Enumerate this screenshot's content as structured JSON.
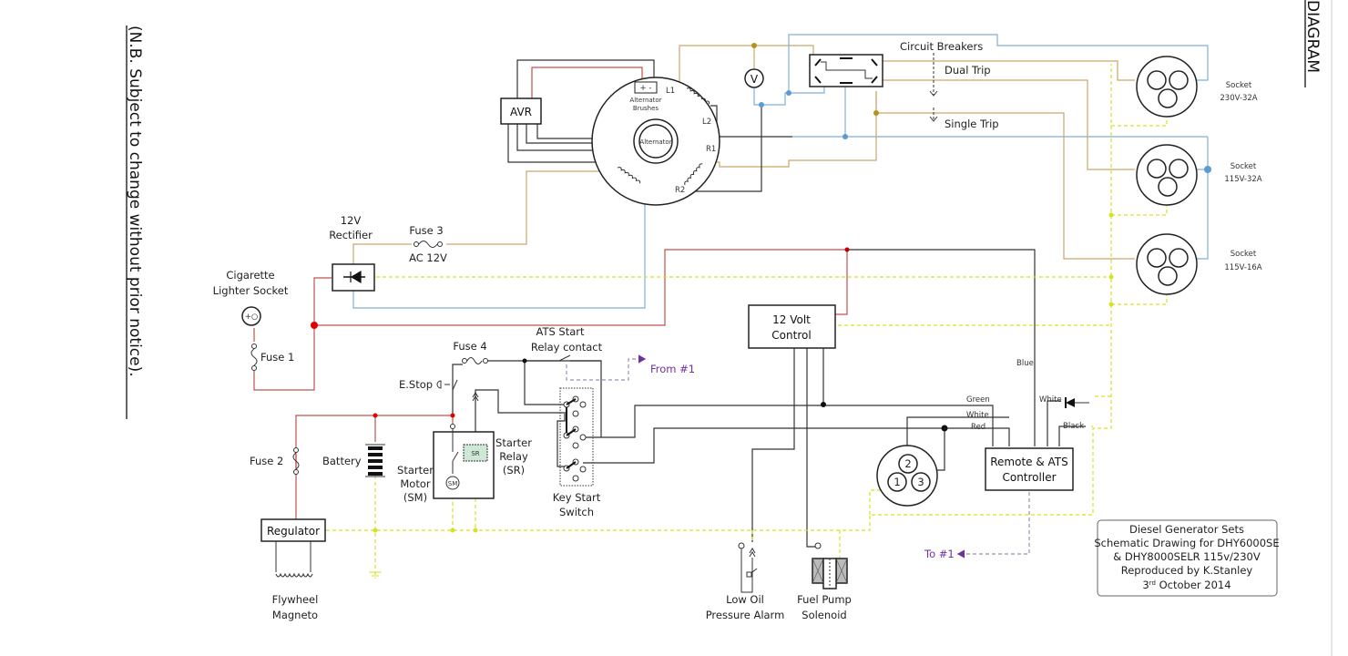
{
  "title": "DIAGRAM",
  "notice": "(N.B. Subject to change without prior notice).",
  "colors": {
    "wire_black": "#333333",
    "wire_red": "#c0504d",
    "wire_blue": "#7fb1d8",
    "wire_brown": "#c9a86a",
    "wire_yellow_earth": "#d9e021",
    "signal_purple": "#7030a0",
    "junction_red": "#e00000",
    "junction_blue": "#5b9bd5",
    "junction_brown": "#b8901f"
  },
  "components": {
    "avr": "AVR",
    "alternator": "Alternator",
    "brushes": {
      "polarity": "+ -",
      "line1": "Alternator",
      "line2": "Brushes"
    },
    "windings": {
      "l1": "L1",
      "l2": "L2",
      "r1": "R1",
      "r2": "R2"
    },
    "voltmeter": "V",
    "circuit_breakers": "Circuit Breakers",
    "dual_trip": "Dual Trip",
    "single_trip": "Single Trip",
    "sockets": [
      {
        "name": "Socket",
        "rating": "230V-32A"
      },
      {
        "name": "Socket",
        "rating": "115V-32A"
      },
      {
        "name": "Socket",
        "rating": "115V-16A"
      }
    ],
    "rectifier": {
      "line1": "12V",
      "line2": "Rectifier"
    },
    "fuse3": {
      "name": "Fuse 3",
      "rating": "AC 12V"
    },
    "cigarette": {
      "line1": "Cigarette",
      "line2": "Lighter Socket",
      "symbol": "+○"
    },
    "fuse1": "Fuse 1",
    "fuse2": "Fuse 2",
    "fuse4": "Fuse 4",
    "estop": "E.Stop",
    "battery": "Battery",
    "regulator": "Regulator",
    "magneto": {
      "line1": "Flywheel",
      "line2": "Magneto"
    },
    "starter_motor": {
      "line1": "Starter",
      "line2": "Motor",
      "line3": "(SM)",
      "symbol": "SM"
    },
    "starter_relay": {
      "line1": "Starter",
      "line2": "Relay",
      "line3": "(SR)",
      "symbol": "SR"
    },
    "ats_relay": {
      "line1": "ATS Start",
      "line2": "Relay contact"
    },
    "from_ref": "From #1",
    "to_ref": "To #1",
    "key_switch": {
      "line1": "Key Start",
      "line2": "Switch"
    },
    "control12v": {
      "line1": "12 Volt",
      "line2": "Control"
    },
    "remote_ats": {
      "line1": "Remote & ATS",
      "line2": "Controller"
    },
    "remote_plug_pins": [
      "2",
      "1",
      "3"
    ],
    "wire_labels": {
      "blue": "Blue",
      "green": "Green",
      "white1": "White",
      "red": "Red",
      "white2": "White",
      "black": "Black"
    },
    "low_oil": {
      "line1": "Low Oil",
      "line2": "Pressure Alarm"
    },
    "fuel_pump": {
      "line1": "Fuel Pump",
      "line2": "Solenoid"
    }
  },
  "title_block": {
    "line1": "Diesel Generator Sets",
    "line2": "Schematic Drawing for DHY6000SE",
    "line3": "& DHY8000SELR 115v/230V",
    "line4": "Reproduced by K.Stanley",
    "line5_day": "3",
    "line5_suffix": "rd",
    "line5_rest": " October 2014"
  }
}
